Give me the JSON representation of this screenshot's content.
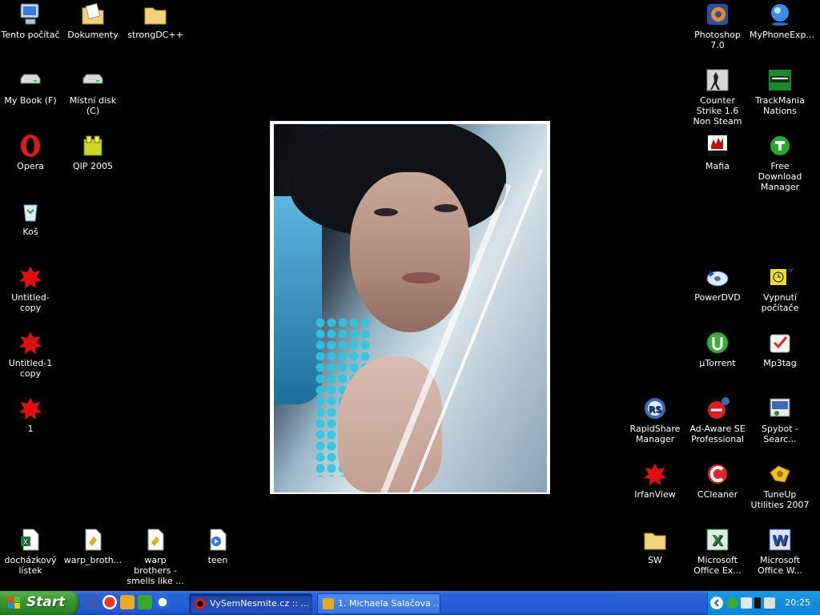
{
  "desktop": {
    "icons": [
      {
        "id": "computer",
        "label": "Tento počítač"
      },
      {
        "id": "documents",
        "label": "Dokumenty"
      },
      {
        "id": "strongdc",
        "label": "strongDC++"
      },
      {
        "id": "mybook",
        "label": "My Book (F)"
      },
      {
        "id": "localdisk",
        "label": "Místní disk (C)"
      },
      {
        "id": "opera",
        "label": "Opera"
      },
      {
        "id": "qip",
        "label": "QIP 2005"
      },
      {
        "id": "recycle",
        "label": "Koš"
      },
      {
        "id": "untitled_copy",
        "label": "Untitled- copy"
      },
      {
        "id": "untitled1_copy",
        "label": "Untitled-1 copy"
      },
      {
        "id": "one",
        "label": "1"
      },
      {
        "id": "dochazkovy",
        "label": "docházkový lístek"
      },
      {
        "id": "warp1",
        "label": "warp_broth..."
      },
      {
        "id": "warp2",
        "label": "warp brothers - smells like ..."
      },
      {
        "id": "teen",
        "label": "teen"
      },
      {
        "id": "photoshop",
        "label": "Photoshop 7.0"
      },
      {
        "id": "myphone",
        "label": "MyPhoneExp..."
      },
      {
        "id": "counterstrike",
        "label": "Counter Strike 1.6 Non Steam"
      },
      {
        "id": "trackmania",
        "label": "TrackMania Nations"
      },
      {
        "id": "mafia",
        "label": "Mafia"
      },
      {
        "id": "fdm",
        "label": "Free Download Manager"
      },
      {
        "id": "powerdvd",
        "label": "PowerDVD"
      },
      {
        "id": "vypnuti",
        "label": "Vypnutí počítače"
      },
      {
        "id": "utorrent",
        "label": "µTorrent"
      },
      {
        "id": "mp3tag",
        "label": "Mp3tag"
      },
      {
        "id": "rapidshare",
        "label": "RapidShare Manager"
      },
      {
        "id": "adaware",
        "label": "Ad-Aware SE Professional"
      },
      {
        "id": "spybot",
        "label": "Spybot - Searc..."
      },
      {
        "id": "irfanview",
        "label": "IrfanView"
      },
      {
        "id": "ccleaner",
        "label": "CCleaner"
      },
      {
        "id": "tuneup",
        "label": "TuneUp Utilities 2007"
      },
      {
        "id": "sw",
        "label": "SW"
      },
      {
        "id": "msexcel",
        "label": "Microsoft Office Ex..."
      },
      {
        "id": "msword",
        "label": "Microsoft Office W..."
      }
    ]
  },
  "taskbar": {
    "start_label": "Start",
    "tasks": [
      {
        "label": "VySemNesmite.cz :: ...",
        "active": true
      },
      {
        "label": "1. Michaela Salačova ...",
        "active": false
      }
    ],
    "clock": "20:25"
  },
  "colors": {
    "desktop_bg": "#000000",
    "taskbar_blue": "#245edb",
    "start_green": "#3c9b33",
    "tray_blue": "#128fe0"
  }
}
